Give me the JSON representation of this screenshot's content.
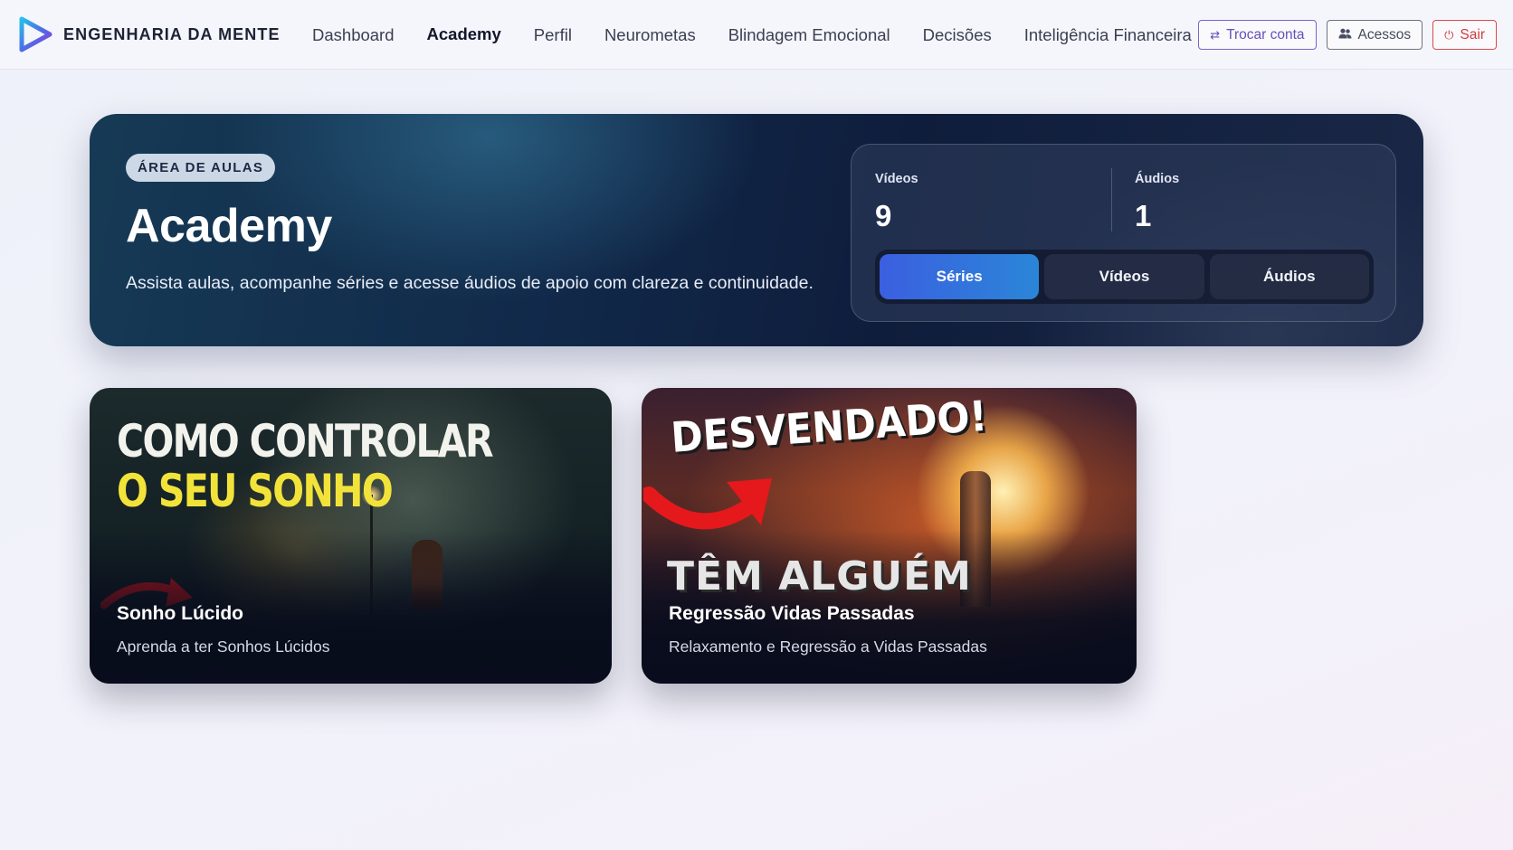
{
  "brand": {
    "name": "ENGENHARIA DA MENTE",
    "logo_icon": "play-triangle-logo-icon"
  },
  "nav": {
    "items": [
      {
        "label": "Dashboard",
        "active": false
      },
      {
        "label": "Academy",
        "active": true
      },
      {
        "label": "Perfil",
        "active": false
      },
      {
        "label": "Neurometas",
        "active": false
      },
      {
        "label": "Blindagem Emocional",
        "active": false
      },
      {
        "label": "Decisões",
        "active": false
      },
      {
        "label": "Inteligência Financeira",
        "active": false
      }
    ]
  },
  "actions": {
    "switch_account": {
      "label": "Trocar conta",
      "icon": "swap-arrows-icon"
    },
    "access": {
      "label": "Acessos",
      "icon": "users-icon"
    },
    "logout": {
      "label": "Sair",
      "icon": "power-icon"
    }
  },
  "hero": {
    "badge": "ÁREA DE AULAS",
    "title": "Academy",
    "description": "Assista aulas, acompanhe séries e acesse áudios de apoio com clareza e continuidade.",
    "stats": [
      {
        "label": "Vídeos",
        "value": "9"
      },
      {
        "label": "Áudios",
        "value": "1"
      }
    ],
    "tabs": [
      {
        "label": "Séries",
        "active": true
      },
      {
        "label": "Vídeos",
        "active": false
      },
      {
        "label": "Áudios",
        "active": false
      }
    ]
  },
  "series": [
    {
      "thumb_line1": "COMO CONTROLAR",
      "thumb_line2": "O SEU SONHO",
      "title": "Sonho Lúcido",
      "subtitle": "Aprenda a ter Sonhos Lúcidos"
    },
    {
      "thumb_line1": "DESVENDADO!",
      "thumb_line2": "TÊM ALGUÉM",
      "title": "Regressão Vidas Passadas",
      "subtitle": "Relaxamento e Regressão a Vidas Passadas"
    }
  ],
  "colors": {
    "accent": "#3b5fe0",
    "switch_button": "#6650b9",
    "logout_button": "#cf3c3c",
    "hero_bg": "#11294a"
  }
}
